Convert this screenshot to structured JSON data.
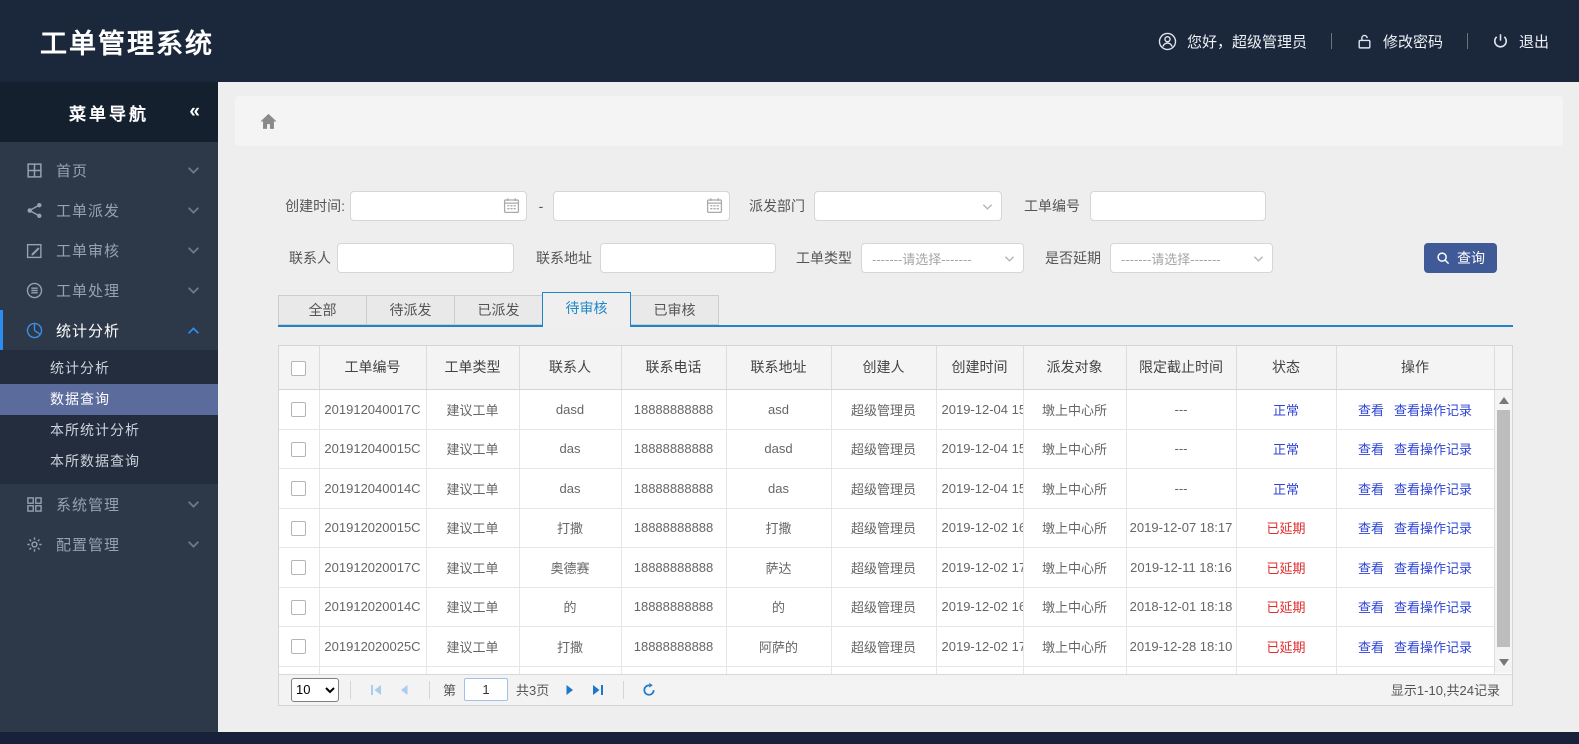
{
  "app": {
    "title": "工单管理系统"
  },
  "header": {
    "greeting": "您好，超级管理员",
    "change_password": "修改密码",
    "logout": "退出",
    "icons": [
      "user-icon",
      "lock-icon",
      "power-icon"
    ]
  },
  "sidebar": {
    "title": "菜单导航",
    "collapse_icon": "«",
    "items": [
      {
        "name": "home",
        "icon": "grid-icon",
        "label": "首页",
        "expandable": true
      },
      {
        "name": "order-dispatch",
        "icon": "share-icon",
        "label": "工单派发",
        "expandable": true
      },
      {
        "name": "order-review",
        "icon": "edit-icon",
        "label": "工单审核",
        "expandable": true
      },
      {
        "name": "order-process",
        "icon": "stack-icon",
        "label": "工单处理",
        "expandable": true
      },
      {
        "name": "statistics",
        "icon": "pie-icon",
        "label": "统计分析",
        "expandable": true,
        "active": true,
        "expanded": true,
        "children": [
          {
            "name": "statistics-analysis",
            "label": "统计分析"
          },
          {
            "name": "data-query",
            "label": "数据查询",
            "selected": true
          },
          {
            "name": "local-statistics",
            "label": "本所统计分析"
          },
          {
            "name": "local-data-query",
            "label": "本所数据查询"
          }
        ]
      },
      {
        "name": "system-manage",
        "icon": "grid2-icon",
        "label": "系统管理",
        "expandable": true
      },
      {
        "name": "config-manage",
        "icon": "gear-icon",
        "label": "配置管理",
        "expandable": true
      }
    ]
  },
  "filters": {
    "created_time": {
      "label": "创建时间:",
      "from_value": "",
      "to_value": "",
      "separator": "-"
    },
    "dispatch_dept": {
      "label": "派发部门",
      "value": ""
    },
    "order_no": {
      "label": "工单编号",
      "value": ""
    },
    "contact": {
      "label": "联系人",
      "value": ""
    },
    "contact_address": {
      "label": "联系地址",
      "value": ""
    },
    "order_type": {
      "label": "工单类型",
      "value": "-------请选择-------"
    },
    "is_delayed": {
      "label": "是否延期",
      "value": "-------请选择-------"
    },
    "search_button": "查询"
  },
  "tabs": {
    "items": [
      {
        "name": "all",
        "label": "全部"
      },
      {
        "name": "to-dispatch",
        "label": "待派发"
      },
      {
        "name": "dispatched",
        "label": "已派发"
      },
      {
        "name": "to-review",
        "label": "待审核",
        "active": true
      },
      {
        "name": "reviewed",
        "label": "已审核"
      }
    ]
  },
  "table": {
    "columns": [
      "工单编号",
      "工单类型",
      "联系人",
      "联系电话",
      "联系地址",
      "创建人",
      "创建时间",
      "派发对象",
      "限定截止时间",
      "状态",
      "操作"
    ],
    "actions": [
      "查看",
      "查看操作记录"
    ],
    "status_colors": {
      "正常": "#2f45d6",
      "已延期": "#e12d2d"
    },
    "rows": [
      {
        "order_no": "201912040017C",
        "order_type": "建议工单",
        "contact": "dasd",
        "phone": "18888888888",
        "address": "asd",
        "creator": "超级管理员",
        "created": "2019-12-04 15",
        "dispatch_to": "墩上中心所",
        "deadline": "---",
        "status": "正常"
      },
      {
        "order_no": "201912040015C",
        "order_type": "建议工单",
        "contact": "das",
        "phone": "18888888888",
        "address": "dasd",
        "creator": "超级管理员",
        "created": "2019-12-04 15",
        "dispatch_to": "墩上中心所",
        "deadline": "---",
        "status": "正常"
      },
      {
        "order_no": "201912040014C",
        "order_type": "建议工单",
        "contact": "das",
        "phone": "18888888888",
        "address": "das",
        "creator": "超级管理员",
        "created": "2019-12-04 15",
        "dispatch_to": "墩上中心所",
        "deadline": "---",
        "status": "正常"
      },
      {
        "order_no": "201912020015C",
        "order_type": "建议工单",
        "contact": "打撒",
        "phone": "18888888888",
        "address": "打撒",
        "creator": "超级管理员",
        "created": "2019-12-02 16",
        "dispatch_to": "墩上中心所",
        "deadline": "2019-12-07 18:17",
        "status": "已延期"
      },
      {
        "order_no": "201912020017C",
        "order_type": "建议工单",
        "contact": "奥德赛",
        "phone": "18888888888",
        "address": "萨达",
        "creator": "超级管理员",
        "created": "2019-12-02 17",
        "dispatch_to": "墩上中心所",
        "deadline": "2019-12-11 18:16",
        "status": "已延期"
      },
      {
        "order_no": "201912020014C",
        "order_type": "建议工单",
        "contact": "的",
        "phone": "18888888888",
        "address": "的",
        "creator": "超级管理员",
        "created": "2019-12-02 16",
        "dispatch_to": "墩上中心所",
        "deadline": "2018-12-01 18:18",
        "status": "已延期"
      },
      {
        "order_no": "201912020025C",
        "order_type": "建议工单",
        "contact": "打撒",
        "phone": "18888888888",
        "address": "阿萨的",
        "creator": "超级管理员",
        "created": "2019-12-02 17",
        "dispatch_to": "墩上中心所",
        "deadline": "2019-12-28 18:10",
        "status": "已延期"
      },
      {
        "order_no": "",
        "order_type": "",
        "contact": "",
        "phone": "",
        "address": "",
        "creator": "",
        "created": "",
        "dispatch_to": "",
        "deadline": "",
        "status": ""
      }
    ]
  },
  "pagination": {
    "page_size": "10",
    "page_prefix": "第",
    "current_page": "1",
    "total_pages": "共3页",
    "summary": "显示1-10,共24记录"
  },
  "colors": {
    "header_navy": "#1b273b",
    "sidebar_slate": "#2d3849",
    "submenu_selected": "#5a6b9c",
    "tab_accent": "#2084c7",
    "link_blue": "#2f45d6",
    "status_normal": "#2f45d6",
    "status_delayed": "#e12d2d",
    "search_button_navy": "#3f5a97"
  }
}
